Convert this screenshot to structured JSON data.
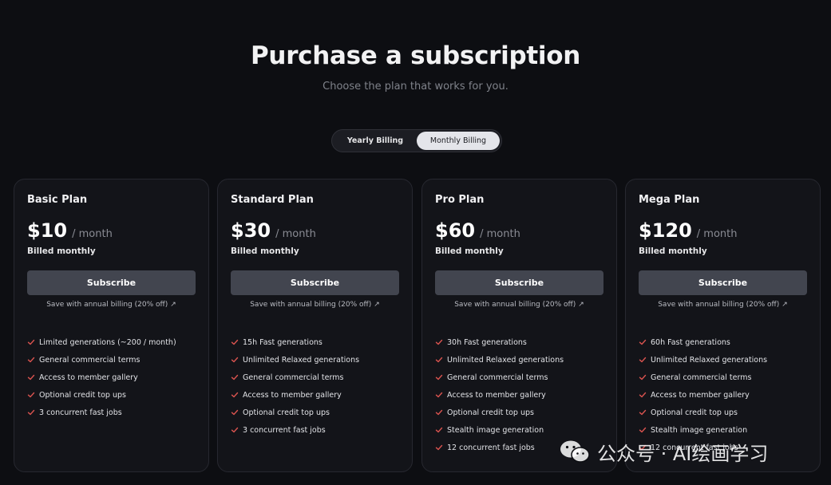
{
  "header": {
    "title": "Purchase a subscription",
    "subtitle": "Choose the plan that works for you."
  },
  "billing_toggle": {
    "options": [
      "Yearly Billing",
      "Monthly Billing"
    ],
    "selected": "Monthly Billing"
  },
  "colors": {
    "background": "#0d0e12",
    "card": "#131419",
    "button": "#42454f",
    "check": "#d9534f"
  },
  "plans": [
    {
      "name": "Basic Plan",
      "price": "$10",
      "period": "/ month",
      "billed": "Billed monthly",
      "button": "Subscribe",
      "save": "Save with annual billing (20% off)",
      "features": [
        "Limited generations (~200 / month)",
        "General commercial terms",
        "Access to member gallery",
        "Optional credit top ups",
        "3 concurrent fast jobs"
      ]
    },
    {
      "name": "Standard Plan",
      "price": "$30",
      "period": "/ month",
      "billed": "Billed monthly",
      "button": "Subscribe",
      "save": "Save with annual billing (20% off)",
      "features": [
        "15h Fast generations",
        "Unlimited Relaxed generations",
        "General commercial terms",
        "Access to member gallery",
        "Optional credit top ups",
        "3 concurrent fast jobs"
      ]
    },
    {
      "name": "Pro Plan",
      "price": "$60",
      "period": "/ month",
      "billed": "Billed monthly",
      "button": "Subscribe",
      "save": "Save with annual billing (20% off)",
      "features": [
        "30h Fast generations",
        "Unlimited Relaxed generations",
        "General commercial terms",
        "Access to member gallery",
        "Optional credit top ups",
        "Stealth image generation",
        "12 concurrent fast jobs"
      ]
    },
    {
      "name": "Mega Plan",
      "price": "$120",
      "period": "/ month",
      "billed": "Billed monthly",
      "button": "Subscribe",
      "save": "Save with annual billing (20% off)",
      "features": [
        "60h Fast generations",
        "Unlimited Relaxed generations",
        "General commercial terms",
        "Access to member gallery",
        "Optional credit top ups",
        "Stealth image generation",
        "12 concurrent fast jobs"
      ]
    }
  ],
  "watermark": {
    "text": "公众号 · AI绘画学习",
    "icon": "wechat-icon"
  }
}
